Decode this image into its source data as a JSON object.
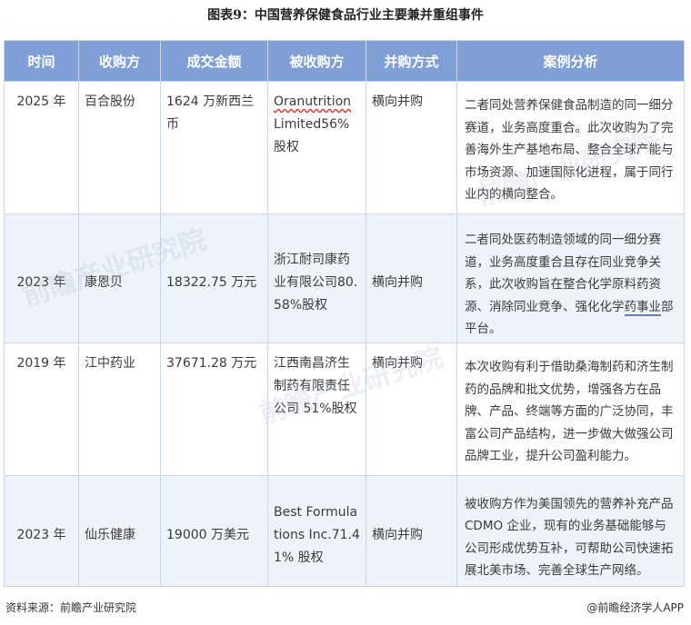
{
  "title": "图表9：中国营养保健食品行业主要兼并重组事件",
  "headers": [
    "时间",
    "收购方",
    "成交金额",
    "被收购方",
    "并购方式",
    "案例分析"
  ],
  "rows": [
    {
      "time": "2025 年",
      "acquirer": "百合股份",
      "amount": "1624 万新西兰币",
      "target_name": "Oranutrition",
      "target_rest": " Limited56%股权",
      "method": "横向并购",
      "analysis": "二者同处营养保健食品制造的同一细分赛道，业务高度重合。此次收购为了完善海外生产基地布局、整合全球产能与市场资源、加速国际化进程，属于同行业内的横向整合。"
    },
    {
      "time": "2023 年",
      "acquirer": "康恩贝",
      "amount": "18322.75 万元",
      "target": "浙江耐司康药业有限公司80.58%股权",
      "method": "横向并购",
      "analysis_pre": "二者同处医药制造领域的同一细分赛道，业务高度重合且存在同业竞争关系，此次收购旨在整合化学原料药资源、消除同业竞争、强化化学",
      "analysis_mark": "药事业",
      "analysis_post": "部平台。"
    },
    {
      "time": "2019 年",
      "acquirer": "江中药业",
      "amount": "37671.28 万元",
      "target": "江西南昌济生制药有限责任公司 51%股权",
      "method": "横向并购",
      "analysis": "本次收购有利于借助桑海制药和济生制药的品牌和批文优势，增强各方在品牌、产品、终端等方面的广泛协同，丰富公司产品结构，进一步做大做强公司品牌工业，提升公司盈利能力。"
    },
    {
      "time": "2023 年",
      "acquirer": "仙乐健康",
      "amount": "19000 万美元",
      "target": "Best Formulations Inc.71.41% 股权",
      "method": "横向并购",
      "analysis": "被收购方作为美国领先的营养补充产品 CDMO 企业，现有的业务基础能够与公司形成优势互补，可帮助公司快速拓展北美市场、完善全球生产网络。"
    }
  ],
  "source": "资料来源：前瞻产业研究院",
  "brand": "@前瞻经济学人APP",
  "watermark": "前瞻产业研究院"
}
